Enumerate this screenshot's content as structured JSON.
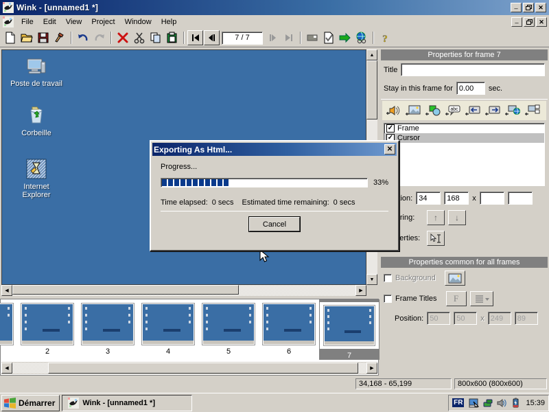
{
  "window": {
    "title": "Wink - [unnamed1 *]",
    "icon": "wink-icon",
    "minimize": "_",
    "maximize": "❐",
    "close": "✕"
  },
  "menubar": {
    "items": [
      {
        "label": "File"
      },
      {
        "label": "Edit"
      },
      {
        "label": "View"
      },
      {
        "label": "Project"
      },
      {
        "label": "Window"
      },
      {
        "label": "Help"
      }
    ],
    "mdi": {
      "minimize": "_",
      "restore": "❐",
      "close": "✕"
    }
  },
  "toolbar": {
    "frame_counter": "7 / 7",
    "buttons": [
      {
        "name": "new-file-button"
      },
      {
        "name": "open-file-button"
      },
      {
        "name": "save-file-button"
      },
      {
        "name": "render-hammer-button"
      },
      {
        "name": "undo-button"
      },
      {
        "name": "redo-button"
      },
      {
        "name": "delete-button"
      },
      {
        "name": "cut-button"
      },
      {
        "name": "copy-button"
      },
      {
        "name": "paste-button"
      },
      {
        "name": "first-frame-button"
      },
      {
        "name": "previous-frame-button"
      },
      {
        "name": "next-frame-button"
      },
      {
        "name": "last-frame-button"
      },
      {
        "name": "minimize-capture-button"
      },
      {
        "name": "properties-button"
      },
      {
        "name": "export-button"
      },
      {
        "name": "browse-button"
      },
      {
        "name": "help-button"
      }
    ]
  },
  "canvas": {
    "background_color": "#3a6ea5",
    "desktop_icons": [
      {
        "label": "Poste de travail",
        "icon": "my-computer-icon"
      },
      {
        "label": "Corbeille",
        "icon": "recycle-bin-icon"
      },
      {
        "label": "Internet Explorer",
        "icon": "internet-explorer-icon"
      }
    ]
  },
  "filmstrip": {
    "frames": [
      {
        "number": "",
        "selected": false
      },
      {
        "number": "2",
        "selected": false
      },
      {
        "number": "3",
        "selected": false
      },
      {
        "number": "4",
        "selected": false
      },
      {
        "number": "5",
        "selected": false
      },
      {
        "number": "6",
        "selected": false
      },
      {
        "number": "7",
        "selected": true
      }
    ]
  },
  "properties_frame": {
    "header": "Properties for frame 7",
    "title_label": "Title",
    "title_value": "",
    "stay_label": "Stay in this frame for",
    "stay_value": "0.00",
    "stay_unit": "sec.",
    "object_buttons": [
      {
        "name": "add-sound-button"
      },
      {
        "name": "add-image-button"
      },
      {
        "name": "add-shape-button"
      },
      {
        "name": "add-textbox-button"
      },
      {
        "name": "add-left-button-button"
      },
      {
        "name": "add-right-button-button"
      },
      {
        "name": "add-browser-link-button"
      },
      {
        "name": "add-new-window-button"
      }
    ],
    "objects": [
      {
        "label": "Frame",
        "checked": true,
        "selected": false
      },
      {
        "label": "Cursor",
        "checked": true,
        "selected": true
      }
    ],
    "position_label": "Position:",
    "position_x": "34",
    "position_y": "168",
    "position_sep": "x",
    "position_w": "",
    "position_h": "",
    "layering_label": "Layering:",
    "layer_up": "↑",
    "layer_down": "↓",
    "properties_label": "Properties:",
    "properties_button": "cursor-properties-button"
  },
  "properties_common": {
    "header": "Properties common for all frames",
    "background_label": "Background",
    "background_checked": false,
    "background_button": "background-image-button",
    "frame_titles_label": "Frame Titles",
    "frame_titles_checked": false,
    "font_button": "F",
    "align_button": "align-dropdown-button",
    "position_label": "Position:",
    "position_x": "50",
    "position_y": "50",
    "position_sep": "x",
    "position_w": "249",
    "position_h": "89"
  },
  "statusbar": {
    "coords": "34,168 - 65,199",
    "size": "800x600 (800x600)"
  },
  "taskbar": {
    "start_label": "Démarrer",
    "tasks": [
      {
        "label": "Wink - [unnamed1 *]",
        "icon": "wink-icon"
      }
    ],
    "tray": {
      "language": "FR",
      "icons": [
        {
          "name": "screen-capture-tray-icon"
        },
        {
          "name": "network-tray-icon"
        },
        {
          "name": "volume-tray-icon"
        },
        {
          "name": "battery-tray-icon"
        }
      ],
      "clock": "15:39"
    }
  },
  "dialog": {
    "title": "Exporting As Html...",
    "close": "✕",
    "progress_label": "Progress...",
    "progress_percent": "33%",
    "progress_value": 33,
    "time_elapsed_label": "Time elapsed:",
    "time_elapsed_value": "0 secs",
    "time_remaining_label": "Estimated time remaining:",
    "time_remaining_value": "0 secs",
    "cancel_label": "Cancel"
  }
}
